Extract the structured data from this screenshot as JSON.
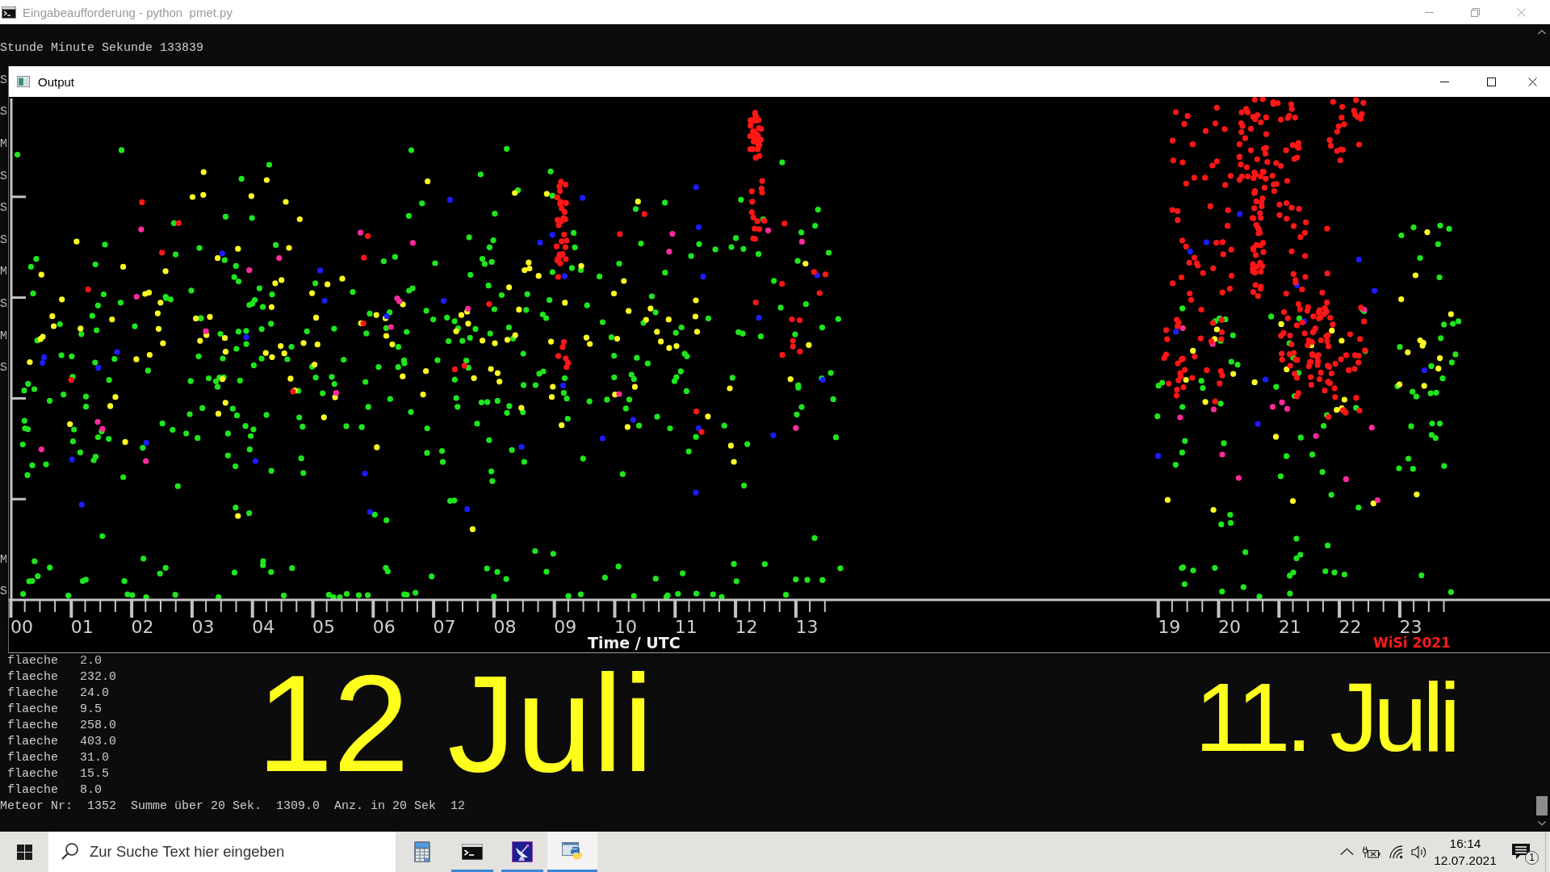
{
  "console": {
    "title": "Eingabeaufforderung - python  pmet.py",
    "top_lines": [
      "Stunde Minute Sekunde 133839"
    ],
    "cut_lines": [
      "S",
      "S",
      "M",
      "S",
      "S",
      "S",
      "M",
      "S",
      "M",
      "S",
      "M",
      "S"
    ],
    "area_lines": [
      "flaeche   2.0",
      "flaeche   232.0",
      "flaeche   24.0",
      "flaeche   9.5",
      "flaeche   258.0",
      "flaeche   403.0",
      "flaeche   31.0",
      "flaeche   15.5",
      "flaeche   8.0"
    ],
    "summary": "Meteor Nr:  1352  Summe über 20 Sek.  1309.0  Anz. in 20 Sek  12"
  },
  "output_window": {
    "title": "Output",
    "plot": {
      "hour_groups": [
        {
          "labels": [
            "00",
            "01",
            "02",
            "03",
            "04",
            "05",
            "06",
            "07",
            "08",
            "09",
            "10",
            "11",
            "12",
            "13"
          ]
        },
        {
          "labels": [
            "19",
            "20",
            "21",
            "22",
            "23"
          ]
        }
      ],
      "axis_title": "Time / UTC",
      "credit": "WiSi 2021"
    }
  },
  "annotations": [
    "12 Juli",
    "11. Juli"
  ],
  "taskbar": {
    "search": {
      "placeholder": "Zur Suche Text hier eingeben"
    },
    "apps": [
      {
        "kind": "calculator",
        "running": false,
        "active": false
      },
      {
        "kind": "terminal",
        "running": true,
        "active": false
      },
      {
        "kind": "dish",
        "running": true,
        "active": false
      },
      {
        "kind": "python",
        "running": true,
        "active": true
      }
    ],
    "clock": {
      "time": "16:14",
      "date": "12.07.2021"
    },
    "notifications": {
      "badge": "1"
    }
  }
}
